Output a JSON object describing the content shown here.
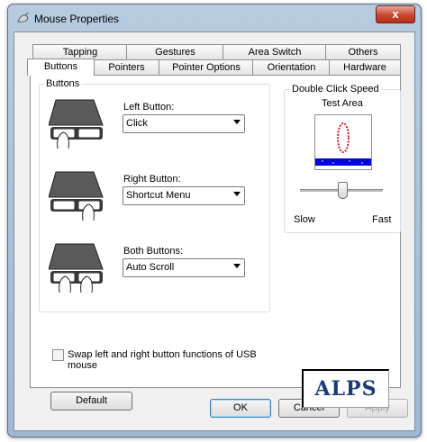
{
  "window": {
    "title": "Mouse Properties",
    "close_glyph": "x"
  },
  "tabs_row1": [
    {
      "label": "Tapping"
    },
    {
      "label": "Gestures"
    },
    {
      "label": "Area Switch"
    },
    {
      "label": "Others"
    }
  ],
  "tabs_row2": [
    {
      "label": "Buttons",
      "active": true
    },
    {
      "label": "Pointers"
    },
    {
      "label": "Pointer Options"
    },
    {
      "label": "Orientation"
    },
    {
      "label": "Hardware"
    }
  ],
  "buttons_group": {
    "title": "Buttons",
    "left": {
      "label": "Left Button:",
      "value": "Click"
    },
    "right": {
      "label": "Right Button:",
      "value": "Shortcut Menu"
    },
    "both": {
      "label": "Both Buttons:",
      "value": "Auto Scroll"
    }
  },
  "dblclick_group": {
    "title": "Double Click Speed",
    "test_area_label": "Test Area",
    "slow_label": "Slow",
    "fast_label": "Fast",
    "slider_level_percent": 50
  },
  "swap_checkbox": {
    "label": "Swap left and right button functions of USB mouse",
    "checked": false
  },
  "logo_text": "ALPS",
  "default_button": "Default",
  "footer": {
    "ok": "OK",
    "cancel": "Cancel",
    "apply": "Apply"
  },
  "colors": {
    "accent_blue": "#0000e0",
    "loop_red": "#d42020",
    "close_red": "#c8452f"
  }
}
